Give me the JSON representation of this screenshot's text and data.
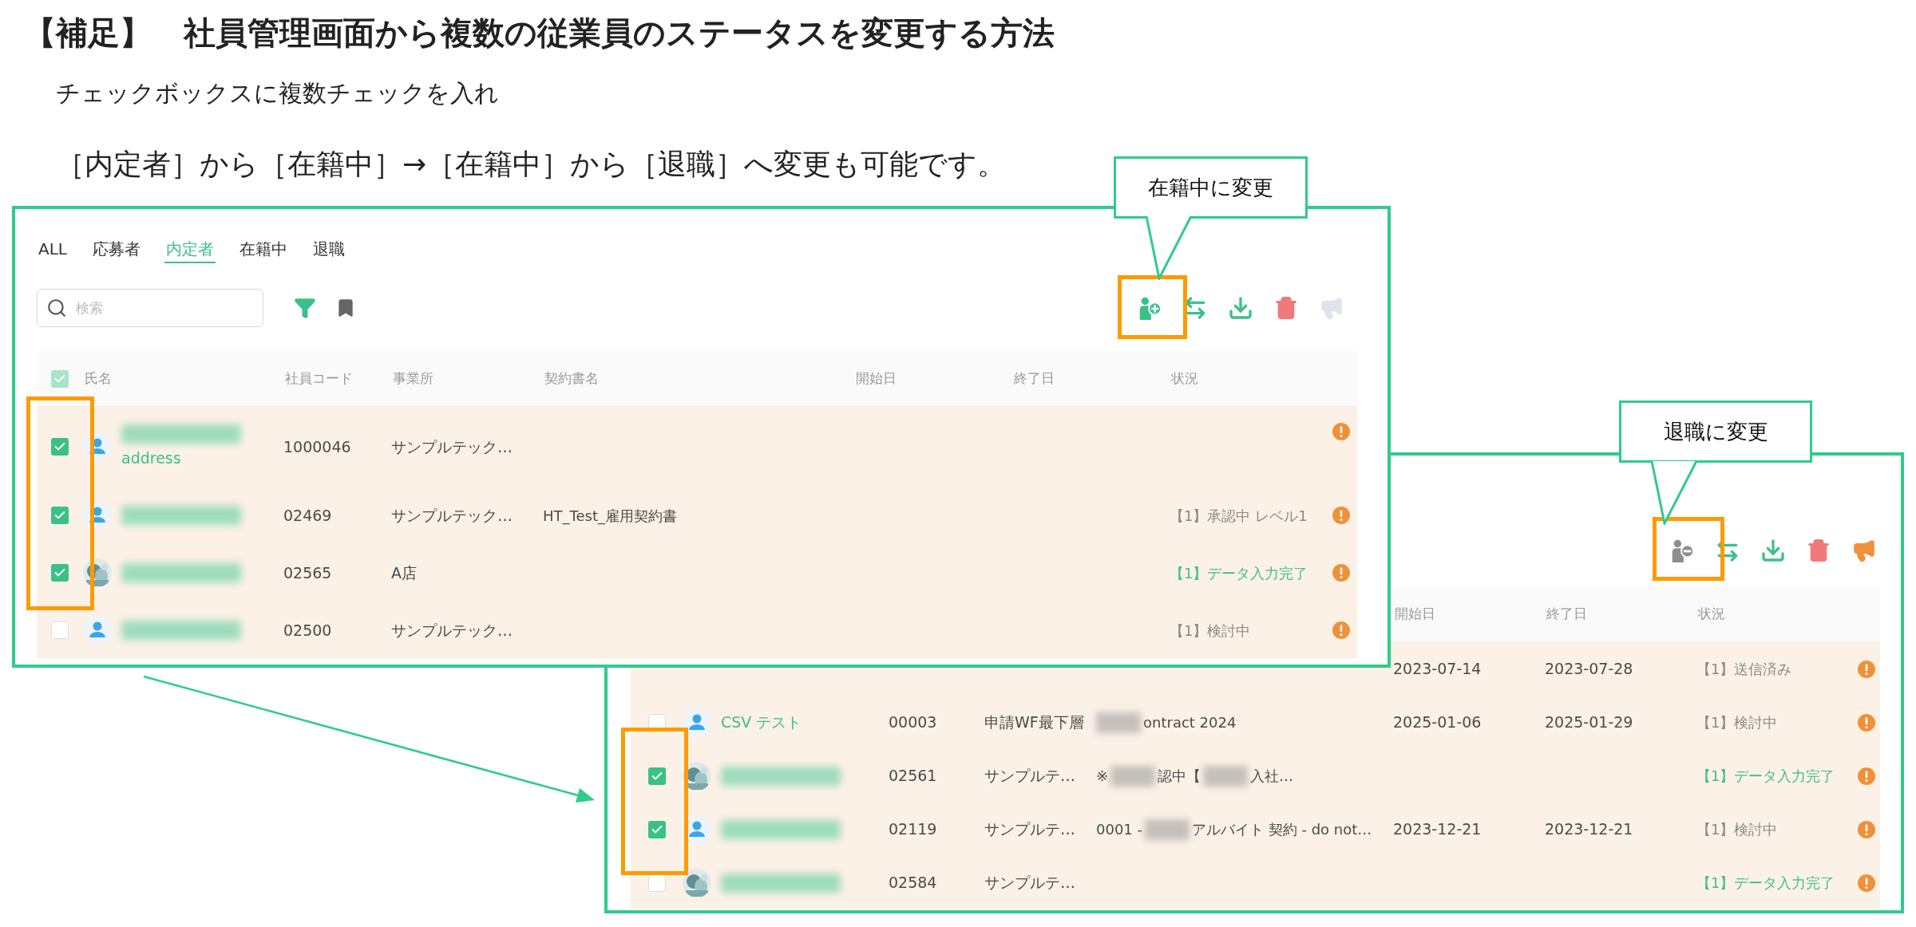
{
  "title": {
    "tag": "【補足】",
    "text": "社員管理画面から複数の従業員のステータスを変更する方法"
  },
  "intro": [
    "チェックボックスに複数チェックを入れ",
    "［内定者］から［在籍中］→［在籍中］から［退職］へ変更も可能です。"
  ],
  "callouts": [
    "在籍中に変更",
    "退職に変更"
  ],
  "panels": [
    {
      "tabs": [
        {
          "label": "ALL",
          "selected": false
        },
        {
          "label": "応募者",
          "selected": false
        },
        {
          "label": "内定者",
          "selected": true
        },
        {
          "label": "在籍中",
          "selected": false
        },
        {
          "label": "退職",
          "selected": false
        }
      ],
      "search": {
        "placeholder": "検索"
      },
      "toolbar": [
        {
          "kind": "person-add",
          "disabled": false
        },
        {
          "kind": "swap",
          "disabled": false
        },
        {
          "kind": "download",
          "disabled": false
        },
        {
          "kind": "delete",
          "disabled": false
        },
        {
          "kind": "announce",
          "disabled": true
        }
      ],
      "header_checkbox": {
        "checked": true
      },
      "columns": [
        "氏名",
        "社員コード",
        "事業所",
        "契約書名",
        "開始日",
        "終了日",
        "状況"
      ],
      "rows": [
        {
          "checked": true,
          "avatar": {
            "kind": "person"
          },
          "sub": "address",
          "code": "1000046",
          "office": "サンプルテック…"
        },
        {
          "checked": true,
          "avatar": {
            "kind": "person"
          },
          "code": "02469",
          "office": "サンプルテック…",
          "contract": [
            {
              "kind": "text",
              "text": "HT_Test_雇用契約書"
            }
          ],
          "status": {
            "text": "【1】承認中 レベル1",
            "color": "#8a8a8a"
          }
        },
        {
          "checked": true,
          "code": "02565",
          "office": "A店",
          "status": {
            "text": "【1】データ入力完了",
            "color": "#3cc08a"
          }
        },
        {
          "checked": false,
          "avatar": {
            "kind": "person"
          },
          "code": "02500",
          "office": "サンプルテック…",
          "status": {
            "text": "【1】検討中",
            "color": "#8a8a8a"
          }
        }
      ]
    },
    {
      "toolbar": [
        {
          "kind": "person-remove",
          "disabled": true
        },
        {
          "kind": "swap",
          "disabled": false
        },
        {
          "kind": "download",
          "disabled": false
        },
        {
          "kind": "delete",
          "disabled": false
        },
        {
          "kind": "announce",
          "disabled": false
        }
      ],
      "columns": [
        "開始日",
        "終了日",
        "状況"
      ],
      "rows": [
        {
          "start": "2023-07-14",
          "end": "2023-07-28",
          "status": {
            "text": "【1】送信済み",
            "color": "#8a8a8a"
          }
        },
        {
          "checked": false,
          "avatar": {
            "kind": "person"
          },
          "name": "CSV テスト",
          "code": "00003",
          "office": "申請WF最下層",
          "contract": [
            {
              "kind": "blur"
            },
            {
              "kind": "text",
              "text": "ontract 2024"
            }
          ],
          "start": "2025-01-06",
          "end": "2025-01-29",
          "status": {
            "text": "【1】検討中",
            "color": "#8a8a8a"
          }
        },
        {
          "checked": true,
          "code": "02561",
          "office": "サンプルテ…",
          "contract": [
            {
              "kind": "text",
              "text": "※"
            },
            {
              "kind": "blur"
            },
            {
              "kind": "text",
              "text": "認中【"
            },
            {
              "kind": "blur"
            },
            {
              "kind": "text",
              "text": "入社…"
            }
          ],
          "status": {
            "text": "【1】データ入力完了",
            "color": "#3cc08a"
          }
        },
        {
          "checked": true,
          "avatar": {
            "kind": "person"
          },
          "code": "02119",
          "office": "サンプルテ…",
          "contract": [
            {
              "kind": "text",
              "text": "0001 -"
            },
            {
              "kind": "blur"
            },
            {
              "kind": "text",
              "text": "アルバイト 契約 - do not…"
            }
          ],
          "start": "2023-12-21",
          "end": "2023-12-21",
          "status": {
            "text": "【1】検討中",
            "color": "#8a8a8a"
          }
        },
        {
          "checked": false,
          "code": "02584",
          "office": "サンプルテ…",
          "status": {
            "text": "【1】データ入力完了",
            "color": "#3cc08a"
          }
        }
      ]
    }
  ]
}
